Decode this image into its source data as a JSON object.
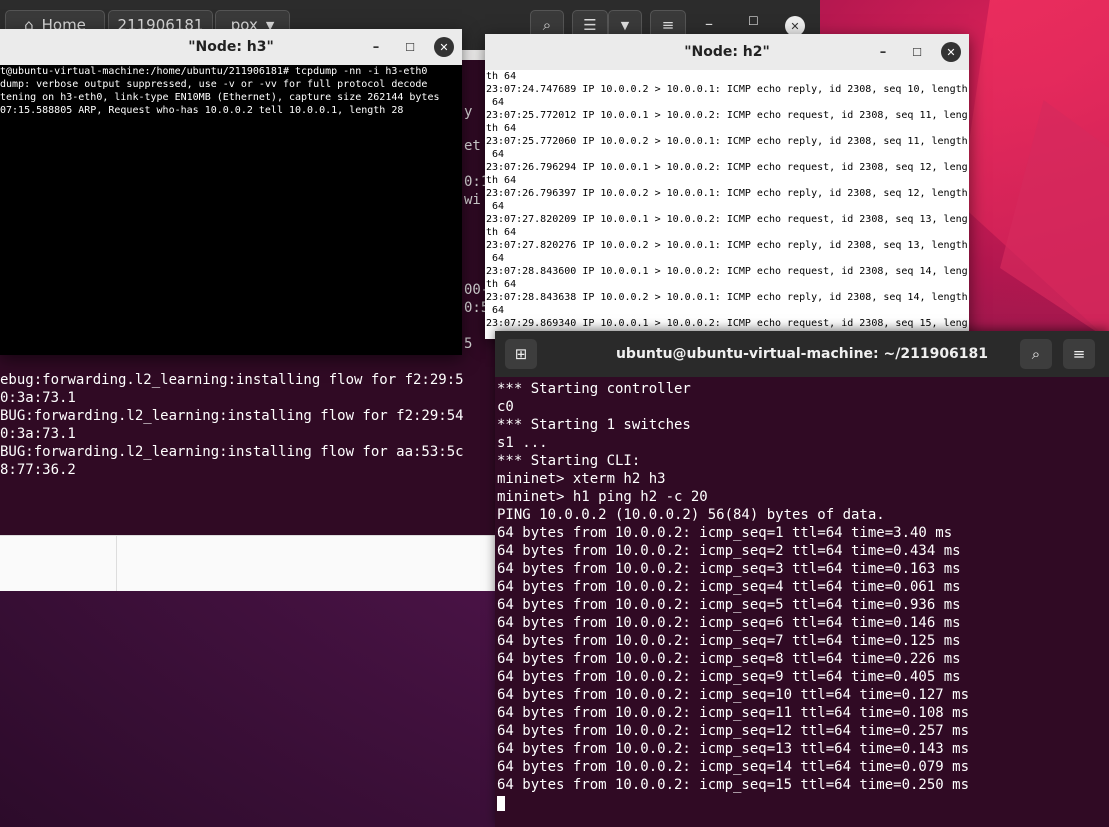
{
  "files": {
    "home_label": "Home",
    "path_segments": [
      "211906181",
      "pox"
    ]
  },
  "pox_terminal": {
    "lines": [
      "ebug:forwarding.l2_learning:installing flow for f2:29:5",
      "0:3a:73.1",
      "BUG:forwarding.l2_learning:installing flow for f2:29:54",
      "0:3a:73.1",
      "BUG:forwarding.l2_learning:installing flow for aa:53:5c",
      "8:77:36.2"
    ],
    "edge_fragments": [
      "y",
      "et",
      "0:1",
      "wi",
      "00-",
      "0:5",
      "5"
    ]
  },
  "h3": {
    "title": "\"Node: h3\"",
    "lines": [
      "t@ubuntu-virtual-machine:/home/ubuntu/211906181# tcpdump -nn -i h3-eth0",
      "dump: verbose output suppressed, use -v or -vv for full protocol decode",
      "tening on h3-eth0, link-type EN10MB (Ethernet), capture size 262144 bytes",
      "07:15.588805 ARP, Request who-has 10.0.0.2 tell 10.0.0.1, length 28"
    ]
  },
  "h2": {
    "title": "\"Node: h2\"",
    "lines": [
      "th 64",
      "23:07:24.747689 IP 10.0.0.2 > 10.0.0.1: ICMP echo reply, id 2308, seq 10, length",
      " 64",
      "23:07:25.772012 IP 10.0.0.1 > 10.0.0.2: ICMP echo request, id 2308, seq 11, leng",
      "th 64",
      "23:07:25.772060 IP 10.0.0.2 > 10.0.0.1: ICMP echo reply, id 2308, seq 11, length",
      " 64",
      "23:07:26.796294 IP 10.0.0.1 > 10.0.0.2: ICMP echo request, id 2308, seq 12, leng",
      "th 64",
      "23:07:26.796397 IP 10.0.0.2 > 10.0.0.1: ICMP echo reply, id 2308, seq 12, length",
      " 64",
      "23:07:27.820209 IP 10.0.0.1 > 10.0.0.2: ICMP echo request, id 2308, seq 13, leng",
      "th 64",
      "23:07:27.820276 IP 10.0.0.2 > 10.0.0.1: ICMP echo reply, id 2308, seq 13, length",
      " 64",
      "23:07:28.843600 IP 10.0.0.1 > 10.0.0.2: ICMP echo request, id 2308, seq 14, leng",
      "th 64",
      "23:07:28.843638 IP 10.0.0.2 > 10.0.0.1: ICMP echo reply, id 2308, seq 14, length",
      " 64",
      "23:07:29.869340 IP 10.0.0.1 > 10.0.0.2: ICMP echo request, id 2308, seq 15, leng"
    ]
  },
  "gterm": {
    "title": "ubuntu@ubuntu-virtual-machine: ~/211906181",
    "lines": [
      "*** Starting controller",
      "c0",
      "*** Starting 1 switches",
      "s1 ...",
      "*** Starting CLI:",
      "mininet> xterm h2 h3",
      "mininet> h1 ping h2 -c 20",
      "PING 10.0.0.2 (10.0.0.2) 56(84) bytes of data.",
      "64 bytes from 10.0.0.2: icmp_seq=1 ttl=64 time=3.40 ms",
      "64 bytes from 10.0.0.2: icmp_seq=2 ttl=64 time=0.434 ms",
      "64 bytes from 10.0.0.2: icmp_seq=3 ttl=64 time=0.163 ms",
      "64 bytes from 10.0.0.2: icmp_seq=4 ttl=64 time=0.061 ms",
      "64 bytes from 10.0.0.2: icmp_seq=5 ttl=64 time=0.936 ms",
      "64 bytes from 10.0.0.2: icmp_seq=6 ttl=64 time=0.146 ms",
      "64 bytes from 10.0.0.2: icmp_seq=7 ttl=64 time=0.125 ms",
      "64 bytes from 10.0.0.2: icmp_seq=8 ttl=64 time=0.226 ms",
      "64 bytes from 10.0.0.2: icmp_seq=9 ttl=64 time=0.405 ms",
      "64 bytes from 10.0.0.2: icmp_seq=10 ttl=64 time=0.127 ms",
      "64 bytes from 10.0.0.2: icmp_seq=11 ttl=64 time=0.108 ms",
      "64 bytes from 10.0.0.2: icmp_seq=12 ttl=64 time=0.257 ms",
      "64 bytes from 10.0.0.2: icmp_seq=13 ttl=64 time=0.143 ms",
      "64 bytes from 10.0.0.2: icmp_seq=14 ttl=64 time=0.079 ms",
      "64 bytes from 10.0.0.2: icmp_seq=15 ttl=64 time=0.250 ms"
    ]
  },
  "colors": {
    "terminal_bg": "#300a24",
    "xterm_bg": "#000000",
    "xterm_h2_bg": "#ffffff"
  }
}
